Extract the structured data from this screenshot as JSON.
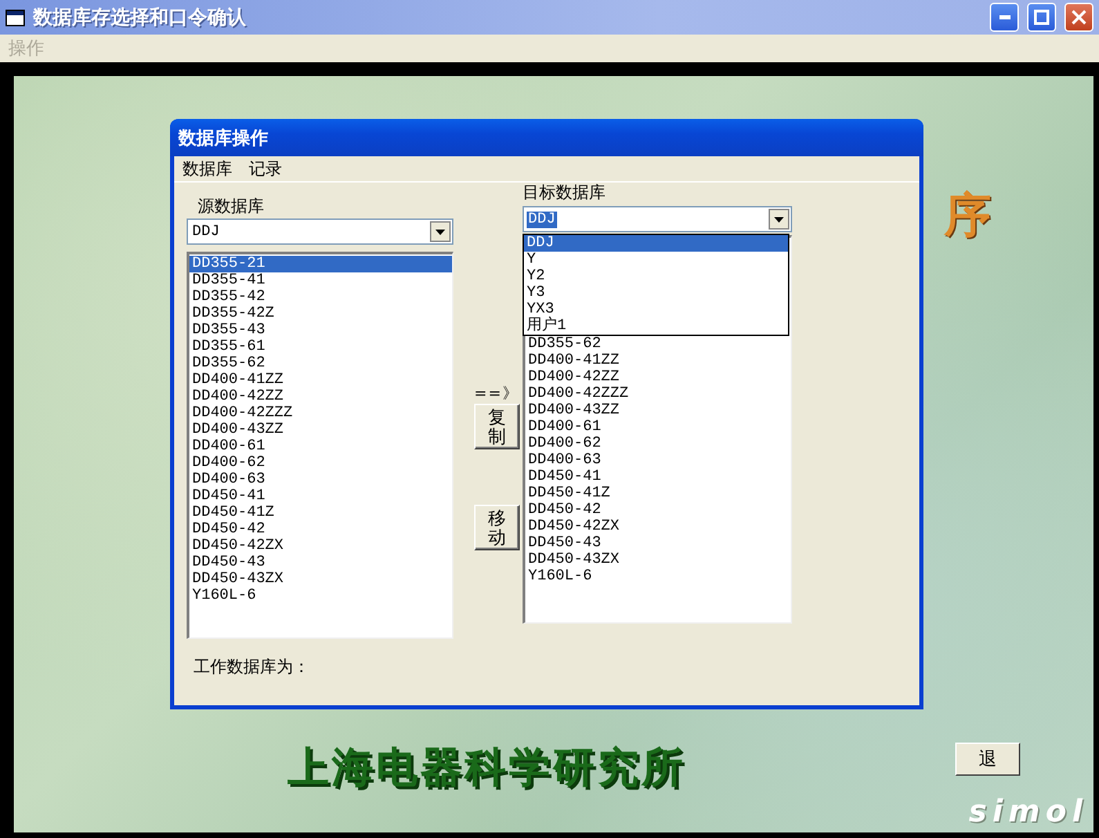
{
  "window": {
    "title": "数据库存选择和口令确认"
  },
  "menu_bar": [
    {
      "label": "操作",
      "disabled": true
    }
  ],
  "background_title_fragment": "序",
  "dialog": {
    "title": "数据库操作",
    "menu": [
      "数据库",
      "记录"
    ],
    "source": {
      "label": "源数据库",
      "combo_value": "DDJ",
      "items": [
        {
          "label": "DD355-21",
          "selected": true
        },
        {
          "label": "DD355-41",
          "selected": false
        },
        {
          "label": "DD355-42",
          "selected": false
        },
        {
          "label": "DD355-42Z",
          "selected": false
        },
        {
          "label": "DD355-43",
          "selected": false
        },
        {
          "label": "DD355-61",
          "selected": false
        },
        {
          "label": "DD355-62",
          "selected": false
        },
        {
          "label": "DD400-41ZZ",
          "selected": false
        },
        {
          "label": "DD400-42ZZ",
          "selected": false
        },
        {
          "label": "DD400-42ZZZ",
          "selected": false
        },
        {
          "label": "DD400-43ZZ",
          "selected": false
        },
        {
          "label": "DD400-61",
          "selected": false
        },
        {
          "label": "DD400-62",
          "selected": false
        },
        {
          "label": "DD400-63",
          "selected": false
        },
        {
          "label": "DD450-41",
          "selected": false
        },
        {
          "label": "DD450-41Z",
          "selected": false
        },
        {
          "label": "DD450-42",
          "selected": false
        },
        {
          "label": "DD450-42ZX",
          "selected": false
        },
        {
          "label": "DD450-43",
          "selected": false
        },
        {
          "label": "DD450-43ZX",
          "selected": false
        },
        {
          "label": "Y160L-6",
          "selected": false
        }
      ]
    },
    "actions": {
      "arrow": "==》",
      "buttons": [
        "复制",
        "移动"
      ]
    },
    "target": {
      "label": "目标数据库",
      "combo_value": "DDJ",
      "dropdown": {
        "expanded": true,
        "options": [
          {
            "label": "DDJ",
            "selected": true
          },
          {
            "label": "Y",
            "selected": false
          },
          {
            "label": "Y2",
            "selected": false
          },
          {
            "label": "Y3",
            "selected": false
          },
          {
            "label": "YX3",
            "selected": false
          },
          {
            "label": "用户1",
            "selected": false
          }
        ]
      },
      "items": [
        {
          "label": "DD355-62",
          "selected": false
        },
        {
          "label": "DD400-41ZZ",
          "selected": false
        },
        {
          "label": "DD400-42ZZ",
          "selected": false
        },
        {
          "label": "DD400-42ZZZ",
          "selected": false
        },
        {
          "label": "DD400-43ZZ",
          "selected": false
        },
        {
          "label": "DD400-61",
          "selected": false
        },
        {
          "label": "DD400-62",
          "selected": false
        },
        {
          "label": "DD400-63",
          "selected": false
        },
        {
          "label": "DD450-41",
          "selected": false
        },
        {
          "label": "DD450-41Z",
          "selected": false
        },
        {
          "label": "DD450-42",
          "selected": false
        },
        {
          "label": "DD450-42ZX",
          "selected": false
        },
        {
          "label": "DD450-43",
          "selected": false
        },
        {
          "label": "DD450-43ZX",
          "selected": false
        },
        {
          "label": "Y160L-6",
          "selected": false
        }
      ]
    },
    "status_label": "工作数据库为："
  },
  "footer": {
    "org_name": "上海电器科学研究所",
    "exit_button": "退",
    "logo": "simol"
  }
}
